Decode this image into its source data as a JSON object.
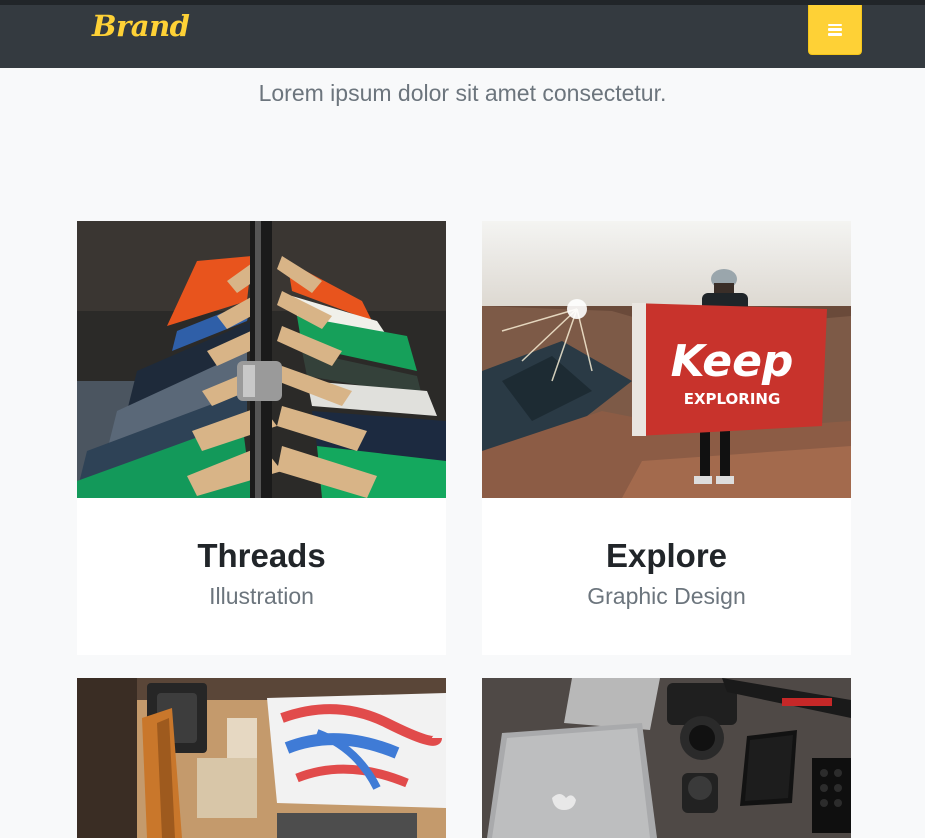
{
  "nav": {
    "brand": "Brand",
    "toggle_icon": "hamburger-icon",
    "accent": "#fed136"
  },
  "header": {
    "subheading": "Lorem ipsum dolor sit amet consectetur."
  },
  "portfolio": {
    "items": [
      {
        "title": "Threads",
        "category": "Illustration",
        "image": "clothes-rack-photo"
      },
      {
        "title": "Explore",
        "category": "Graphic Design",
        "image": "keep-exploring-flag-photo",
        "flag_text_1": "Keep",
        "flag_text_2": "EXPLORING"
      },
      {
        "title": "",
        "category": "",
        "image": "workshop-tools-photo"
      },
      {
        "title": "",
        "category": "",
        "image": "camera-laptop-flatlay-photo"
      }
    ]
  }
}
